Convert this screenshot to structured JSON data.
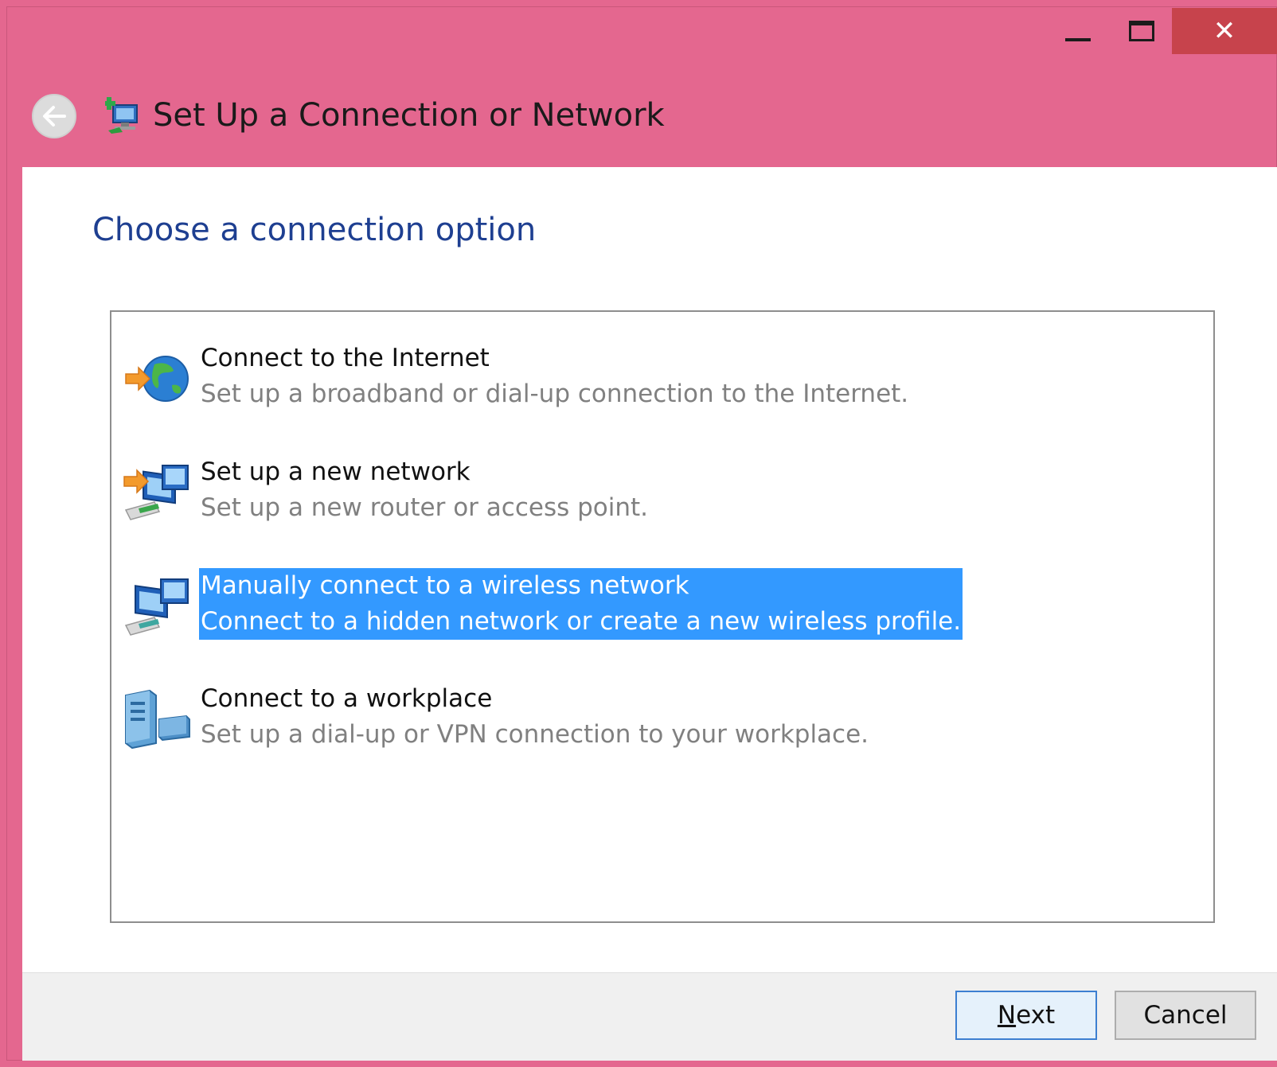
{
  "window": {
    "title": "Set Up a Connection or Network",
    "accent_color": "#e4678f",
    "close_glyph": "✕",
    "minimize_glyph": "",
    "maximize_glyph": ""
  },
  "page": {
    "heading": "Choose a connection option"
  },
  "options": [
    {
      "title": "Connect to the Internet",
      "description": "Set up a broadband or dial-up connection to the Internet.",
      "icon": "globe-connect-icon",
      "selected": false
    },
    {
      "title": "Set up a new network",
      "description": "Set up a new router or access point.",
      "icon": "new-network-icon",
      "selected": false
    },
    {
      "title": "Manually connect to a wireless network",
      "description": "Connect to a hidden network or create a new wireless profile.",
      "icon": "wireless-network-icon",
      "selected": true
    },
    {
      "title": "Connect to a workplace",
      "description": "Set up a dial-up or VPN connection to your workplace.",
      "icon": "workplace-server-icon",
      "selected": false
    }
  ],
  "footer": {
    "next_prefix": "N",
    "next_rest": "ext",
    "cancel_label": "Cancel"
  }
}
